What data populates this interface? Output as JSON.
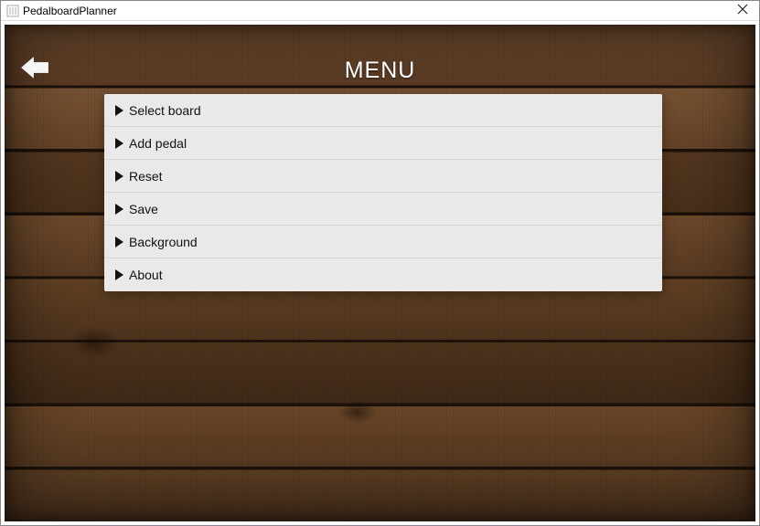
{
  "window": {
    "title": "PedalboardPlanner"
  },
  "header": {
    "title": "MENU"
  },
  "menu": {
    "items": [
      {
        "label": "Select board"
      },
      {
        "label": "Add pedal"
      },
      {
        "label": "Reset"
      },
      {
        "label": "Save"
      },
      {
        "label": "Background"
      },
      {
        "label": "About"
      }
    ]
  },
  "colors": {
    "panel_bg": "#e9e9e9",
    "text": "#111111",
    "title_text": "#ffffff"
  }
}
